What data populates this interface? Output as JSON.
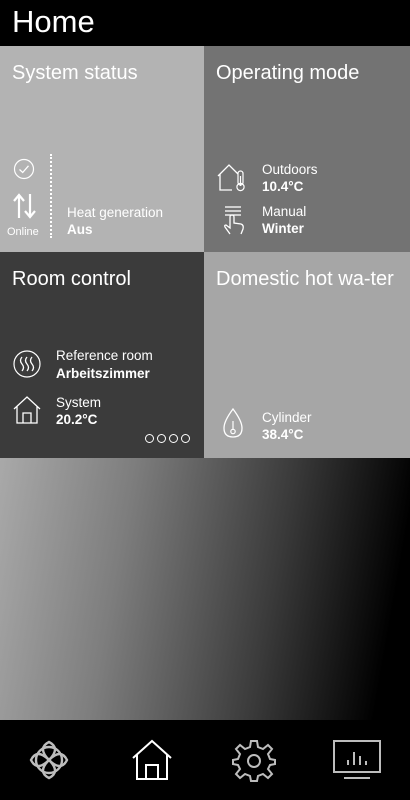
{
  "header": {
    "title": "Home"
  },
  "system_status": {
    "title": "System status",
    "online_label": "Online",
    "heat_generation_label": "Heat generation",
    "heat_generation_value": "Aus"
  },
  "operating_mode": {
    "title": "Operating mode",
    "outdoors_label": "Outdoors",
    "outdoors_value": "10.4°C",
    "manual_label": "Manual",
    "manual_value": "Winter"
  },
  "room_control": {
    "title": "Room control",
    "reference_room_label": "Reference room",
    "reference_room_value": "Arbeitszimmer",
    "system_label": "System",
    "system_value": "20.2°C"
  },
  "domestic_hot_water": {
    "title": "Domestic hot wa-ter",
    "cylinder_label": "Cylinder",
    "cylinder_value": "38.4°C"
  },
  "navbar": {
    "items": [
      {
        "icon": "celtic-knot-icon"
      },
      {
        "icon": "home-icon"
      },
      {
        "icon": "gear-icon"
      },
      {
        "icon": "monitor-chart-icon"
      }
    ]
  }
}
